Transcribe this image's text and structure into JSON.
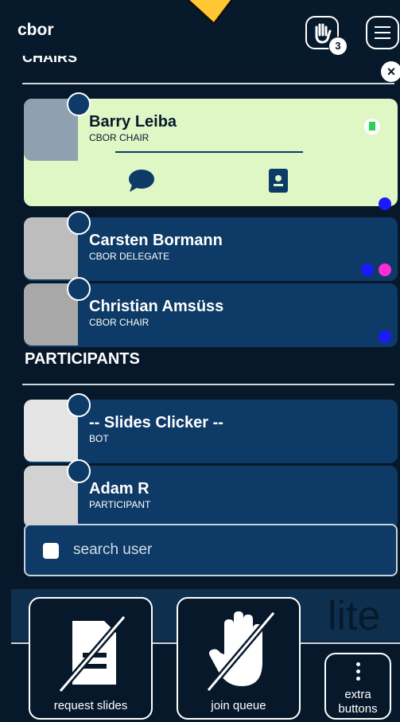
{
  "app_title": "cbor",
  "queue_count": "3",
  "close_symbol": "×",
  "section_chairs_partial": "CHAIRS",
  "chairs": [
    {
      "name": "Barry Leiba",
      "role": "CBOR CHAIR",
      "badge": "info-icon"
    },
    {
      "name": "Carsten Bormann",
      "role": "CBOR DELEGATE",
      "badge": "info-icon"
    },
    {
      "name": "Christian Amsüss",
      "role": "CBOR CHAIR",
      "badge": "home-icon"
    }
  ],
  "section_participants": "PARTICIPANTS",
  "participants": [
    {
      "name": "-- Slides Clicker --",
      "role": "BOT",
      "badge": "home-icon"
    },
    {
      "name": "Adam R",
      "role": "PARTICIPANT",
      "badge": "mobile-icon"
    }
  ],
  "search": {
    "placeholder": "search user"
  },
  "brand_lite": "lite",
  "buttons": {
    "request_slides": "request slides",
    "join_queue": "join queue",
    "extra_line1": "extra",
    "extra_line2": "buttons"
  },
  "colors": {
    "accent": "#ffc832",
    "highlight_card": "#dff7c4",
    "card": "#0d3a66",
    "blue_dot": "#1a1aff",
    "pink_dot": "#ff2bd6"
  }
}
